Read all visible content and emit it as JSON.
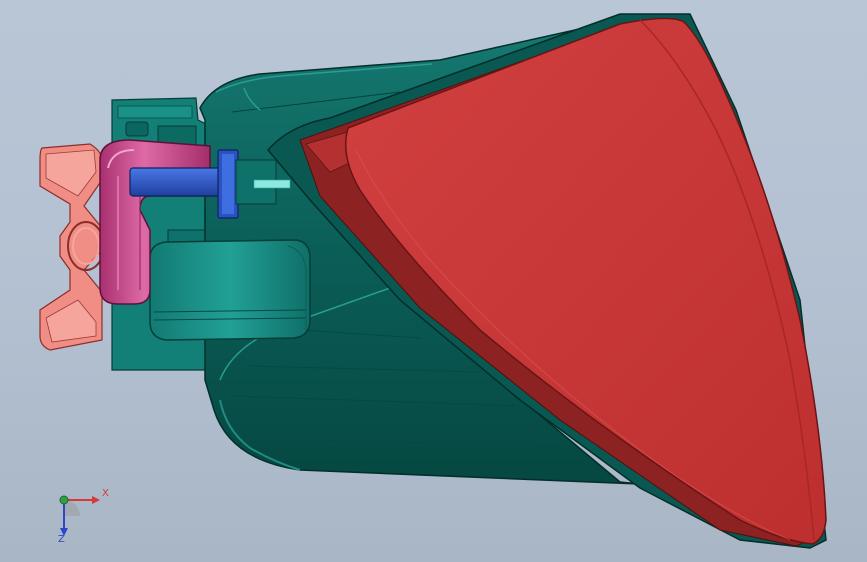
{
  "viewport": {
    "background_color": "#b4c1d2",
    "model_parts": [
      {
        "name": "lens-cover",
        "color": "#c93636"
      },
      {
        "name": "housing",
        "color": "#0f6b64"
      },
      {
        "name": "connector-elbow",
        "color": "#c0427f"
      },
      {
        "name": "bolt",
        "color": "#2f57c8"
      },
      {
        "name": "bracket-clip",
        "color": "#f08a82"
      },
      {
        "name": "lower-module",
        "color": "#1a8f86"
      }
    ]
  },
  "triad": {
    "x_label": "X",
    "z_label": "Z",
    "x_color": "#d43a3a",
    "y_color": "#2ea043",
    "z_color": "#2f45c8"
  }
}
